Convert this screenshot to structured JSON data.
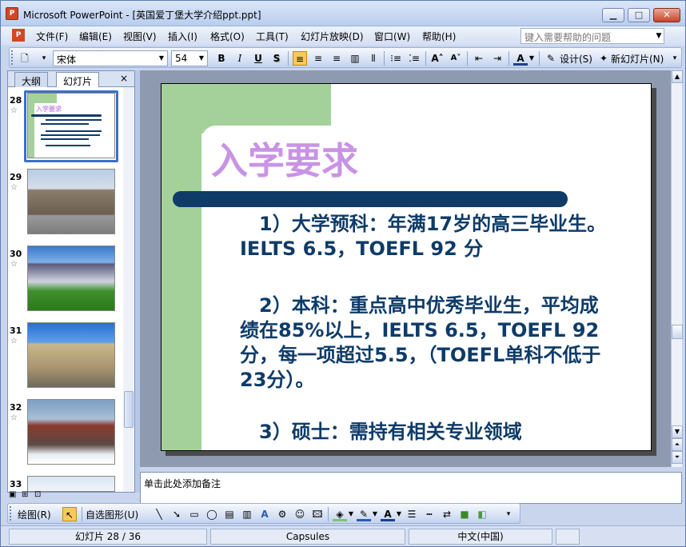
{
  "window": {
    "title": "Microsoft PowerPoint - [英国爱丁堡大学介绍ppt.ppt]",
    "minimize": "▁",
    "maximize": "□",
    "close": "✕"
  },
  "menu": {
    "items": [
      "文件(F)",
      "编辑(E)",
      "视图(V)",
      "插入(I)",
      "格式(O)",
      "工具(T)",
      "幻灯片放映(D)",
      "窗口(W)",
      "帮助(H)"
    ],
    "help_placeholder": "键入需要帮助的问题"
  },
  "toolbar": {
    "font": "宋体",
    "size": "54",
    "bold": "B",
    "italic": "I",
    "underline": "U",
    "shadow": "S",
    "design_label": "设计(S)",
    "new_slide_label": "新幻灯片(N)"
  },
  "panel": {
    "tab_outline": "大纲",
    "tab_slides": "幻灯片",
    "close": "×",
    "thumbs": [
      {
        "num": "28"
      },
      {
        "num": "29"
      },
      {
        "num": "30"
      },
      {
        "num": "31"
      },
      {
        "num": "32"
      },
      {
        "num": "33"
      }
    ]
  },
  "slide": {
    "title": "入学要求",
    "para1": "　1）大学预科：年满17岁的高三毕业生。IELTS 6.5，TOEFL 92 分",
    "para2": "　2）本科：重点高中优秀毕业生，平均成绩在85%以上，IELTS 6.5，TOEFL 92分，每一项超过5.5，（TOEFL单科不低于23分）。",
    "para3": "　3）硕士：需持有相关专业领域"
  },
  "notes": {
    "placeholder": "单击此处添加备注"
  },
  "drawing": {
    "draw_label": "绘图(R)",
    "autoshapes_label": "自选图形(U)"
  },
  "status": {
    "slide": "幻灯片 28 / 36",
    "design": "Capsules",
    "lang": "中文(中国)"
  },
  "colors": {
    "title": "#c993e5",
    "body": "#0e3b68",
    "accent_green": "#a4d19a"
  }
}
